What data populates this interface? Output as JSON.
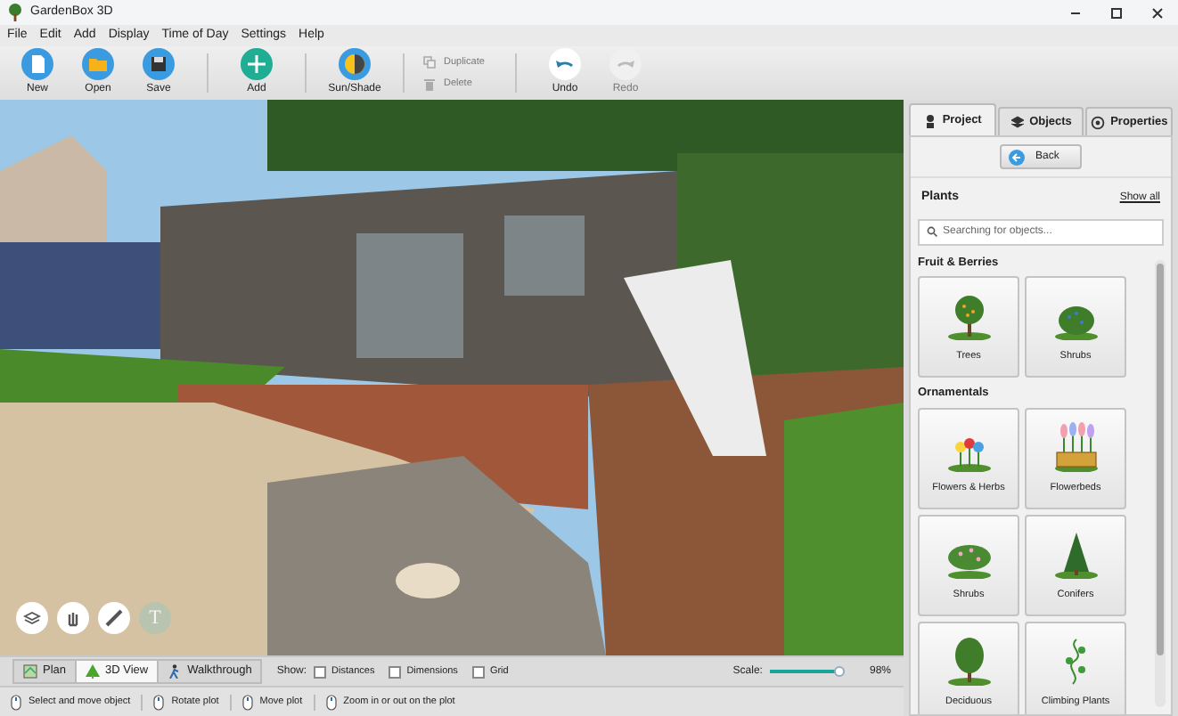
{
  "window": {
    "title": "GardenBox 3D"
  },
  "menu": [
    "File",
    "Edit",
    "Add",
    "Display",
    "Time of Day",
    "Settings",
    "Help"
  ],
  "toolbar": [
    [
      {
        "label": "New",
        "disabled": false
      },
      {
        "label": "Open",
        "disabled": false
      },
      {
        "label": "Save",
        "disabled": false
      }
    ],
    [
      {
        "label": "Add",
        "disabled": false
      }
    ],
    [
      {
        "label": "Sun/Shade",
        "disabled": false
      }
    ],
    [
      {
        "label": "Duplicate",
        "disabled": true
      },
      {
        "label": "Delete",
        "disabled": true
      }
    ],
    [
      {
        "label": "Undo",
        "disabled": false
      },
      {
        "label": "Redo",
        "disabled": true
      }
    ]
  ],
  "view_tools": [
    {
      "disabled": false
    },
    {
      "disabled": false
    },
    {
      "disabled": false
    },
    {
      "label": "T",
      "disabled": true
    }
  ],
  "view_tabs": [
    {
      "label": "Plan",
      "selected": false
    },
    {
      "label": "3D View",
      "selected": true
    },
    {
      "label": "Walkthrough",
      "selected": false
    }
  ],
  "show": {
    "label": "Show:",
    "options": [
      {
        "label": "Distances",
        "checked": false
      },
      {
        "label": "Dimensions",
        "checked": false
      },
      {
        "label": "Grid",
        "checked": false
      }
    ]
  },
  "scale": {
    "label": "Scale:",
    "level": 0.96,
    "reading": "98%"
  },
  "status_bar": [
    "Select and move object",
    "Rotate plot",
    "Move plot",
    "Zoom in or out on the plot"
  ],
  "panel": {
    "tabs": [
      {
        "label": "Project",
        "selected": true
      },
      {
        "label": "Objects",
        "selected": false
      },
      {
        "label": "Properties",
        "selected": false
      }
    ],
    "back": "Back",
    "heading": "Plants",
    "show_all": "Show all",
    "search": {
      "placeholder": "Searching for objects..."
    },
    "sections": [
      {
        "title": "Fruit & Berries",
        "items": [
          "Trees",
          "Shrubs"
        ]
      },
      {
        "title": "Ornamentals",
        "items": [
          "Flowers & Herbs",
          "Flowerbeds",
          "Shrubs",
          "Conifers",
          "Deciduous",
          "Climbing Plants"
        ]
      }
    ]
  }
}
